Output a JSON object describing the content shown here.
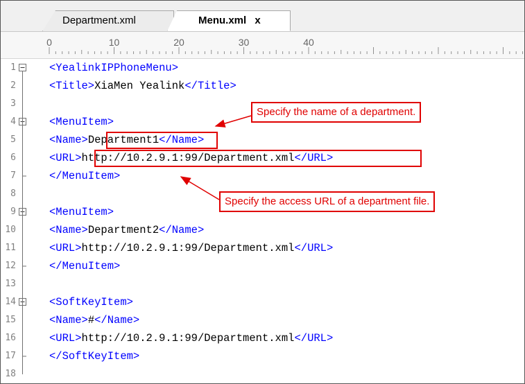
{
  "tabs": [
    {
      "label": "Department.xml",
      "active": false
    },
    {
      "label": "Menu.xml",
      "active": true,
      "close": "x"
    }
  ],
  "ruler": {
    "labels": [
      "0",
      "10",
      "20",
      "30",
      "40"
    ]
  },
  "lines": [
    {
      "num": "1",
      "fold": "open",
      "parts": [
        {
          "t": "tag",
          "v": "<YealinkIPPhoneMenu>"
        }
      ]
    },
    {
      "num": "2",
      "fold": "",
      "parts": [
        {
          "t": "tag",
          "v": "<Title>"
        },
        {
          "t": "txt",
          "v": "XiaMen Yealink"
        },
        {
          "t": "tag",
          "v": "</Title>"
        }
      ]
    },
    {
      "num": "3",
      "fold": "",
      "parts": []
    },
    {
      "num": "4",
      "fold": "open",
      "parts": [
        {
          "t": "tag",
          "v": "<MenuItem>"
        }
      ]
    },
    {
      "num": "5",
      "fold": "",
      "parts": [
        {
          "t": "tag",
          "v": "<Name>"
        },
        {
          "t": "txt",
          "v": "Department1"
        },
        {
          "t": "tag",
          "v": "</Name>"
        }
      ]
    },
    {
      "num": "6",
      "fold": "",
      "parts": [
        {
          "t": "tag",
          "v": "<URL>"
        },
        {
          "t": "txt",
          "v": "http://10.2.9.1:99/Department.xml"
        },
        {
          "t": "tag",
          "v": "</URL>"
        }
      ]
    },
    {
      "num": "7",
      "fold": "end",
      "parts": [
        {
          "t": "tag",
          "v": "</MenuItem>"
        }
      ]
    },
    {
      "num": "8",
      "fold": "",
      "parts": []
    },
    {
      "num": "9",
      "fold": "open",
      "parts": [
        {
          "t": "tag",
          "v": "<MenuItem>"
        }
      ]
    },
    {
      "num": "10",
      "fold": "",
      "parts": [
        {
          "t": "tag",
          "v": "<Name>"
        },
        {
          "t": "txt",
          "v": "Department2"
        },
        {
          "t": "tag",
          "v": "</Name>"
        }
      ]
    },
    {
      "num": "11",
      "fold": "",
      "parts": [
        {
          "t": "tag",
          "v": "<URL>"
        },
        {
          "t": "txt",
          "v": "http://10.2.9.1:99/Department.xml"
        },
        {
          "t": "tag",
          "v": "</URL>"
        }
      ]
    },
    {
      "num": "12",
      "fold": "end",
      "parts": [
        {
          "t": "tag",
          "v": "</MenuItem>"
        }
      ]
    },
    {
      "num": "13",
      "fold": "",
      "parts": []
    },
    {
      "num": "14",
      "fold": "open",
      "parts": [
        {
          "t": "tag",
          "v": "<SoftKeyItem>"
        }
      ]
    },
    {
      "num": "15",
      "fold": "",
      "parts": [
        {
          "t": "tag",
          "v": "<Name>"
        },
        {
          "t": "txt",
          "v": "#"
        },
        {
          "t": "tag",
          "v": "</Name>"
        }
      ]
    },
    {
      "num": "16",
      "fold": "",
      "parts": [
        {
          "t": "tag",
          "v": "<URL>"
        },
        {
          "t": "txt",
          "v": "http://10.2.9.1:99/Department.xml"
        },
        {
          "t": "tag",
          "v": "</URL>"
        }
      ]
    },
    {
      "num": "17",
      "fold": "end",
      "parts": [
        {
          "t": "tag",
          "v": "</SoftKeyItem>"
        }
      ]
    },
    {
      "num": "18",
      "fold": "",
      "parts": []
    }
  ],
  "annotations": {
    "name_callout": "Specify the name of a department.",
    "url_callout": "Specify the access URL of a department file."
  },
  "colors": {
    "tag": "#0000ff",
    "text": "#000000",
    "annotation": "#e00000"
  }
}
